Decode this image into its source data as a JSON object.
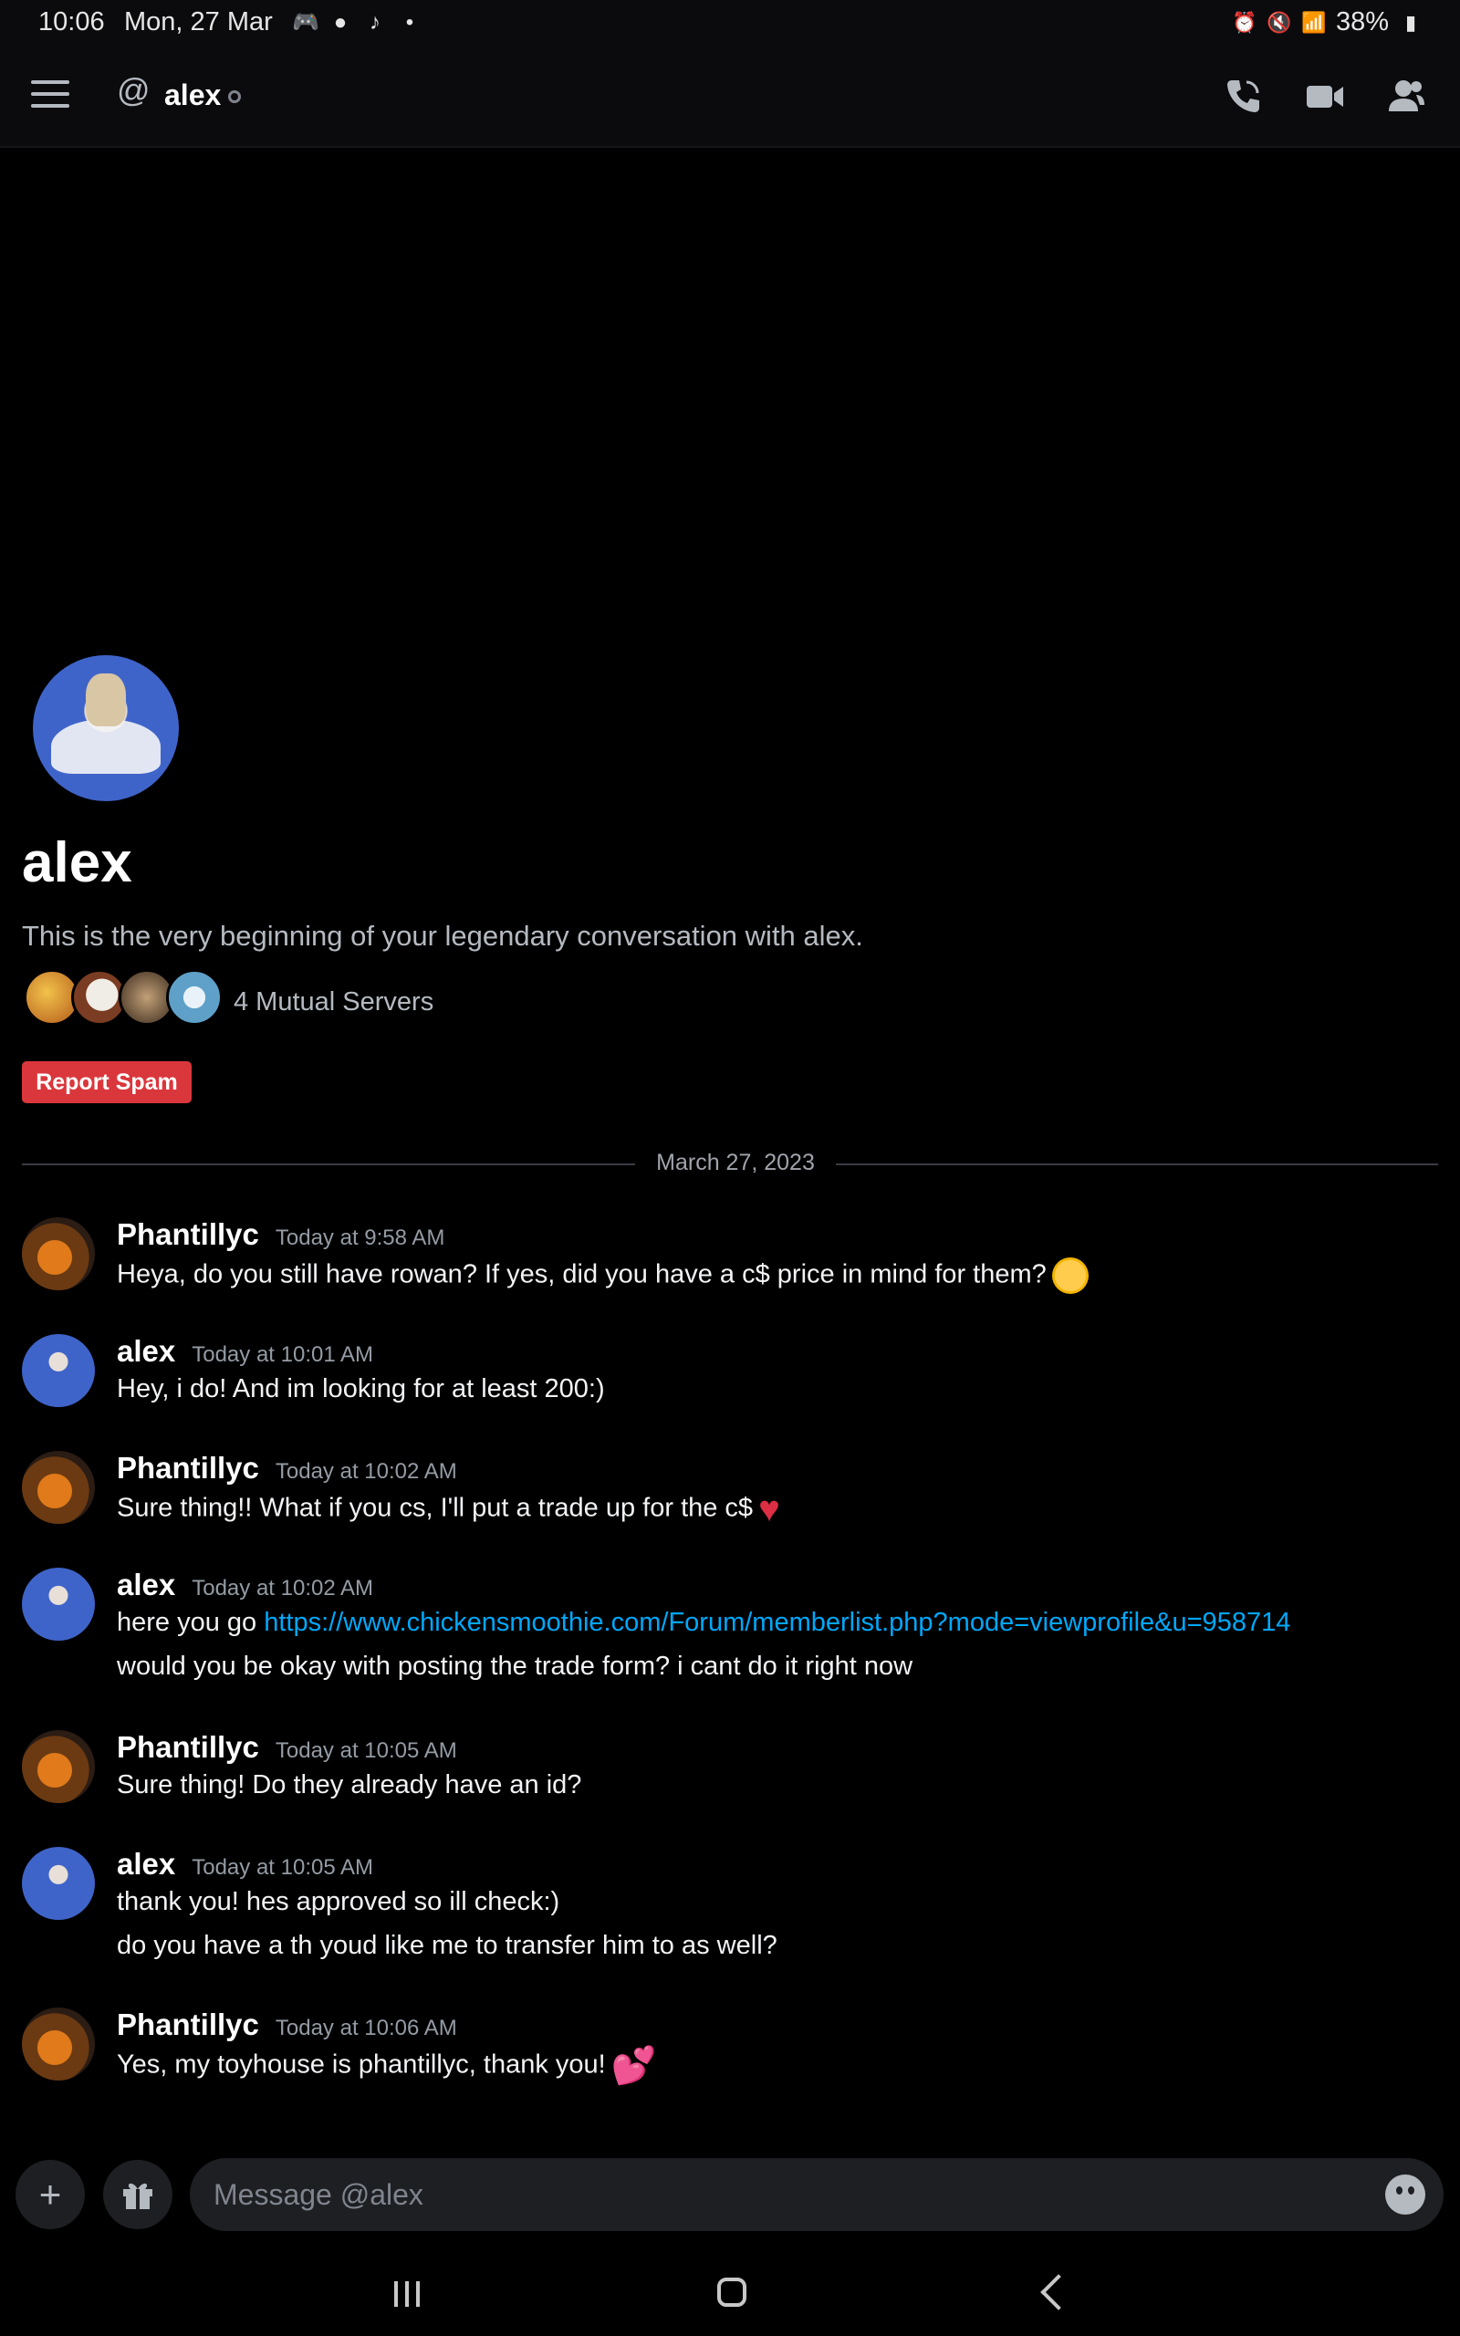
{
  "status_bar": {
    "time": "10:06",
    "date": "Mon, 27 Mar",
    "battery": "38%"
  },
  "header": {
    "title": "alex"
  },
  "intro": {
    "name": "alex",
    "description": "This is the very beginning of your legendary conversation with alex.",
    "mutual_servers": "4 Mutual Servers",
    "report_label": "Report Spam"
  },
  "divider_date": "March 27, 2023",
  "messages": [
    {
      "author": "Phantillyc",
      "timestamp": "Today at 9:58 AM",
      "lines": [
        "Heya, do you still have rowan? If yes, did you have a c$ price in mind for them?"
      ],
      "emoji": "face-with-rolling-eyes"
    },
    {
      "author": "alex",
      "timestamp": "Today at 10:01 AM",
      "lines": [
        "Hey, i do! And im looking for at least 200:)"
      ]
    },
    {
      "author": "Phantillyc",
      "timestamp": "Today at 10:02 AM",
      "lines": [
        "Sure thing!! What if you cs, I'll put a trade up for the c$"
      ],
      "emoji": "heart"
    },
    {
      "author": "alex",
      "timestamp": "Today at 10:02 AM",
      "lines": [
        "here you go",
        "would you be okay with posting the trade form? i cant do it right now"
      ],
      "link": "https://www.chickensmoothie.com/Forum/memberlist.php?mode=viewprofile&u=958714"
    },
    {
      "author": "Phantillyc",
      "timestamp": "Today at 10:05 AM",
      "lines": [
        "Sure thing! Do they already have an id?"
      ]
    },
    {
      "author": "alex",
      "timestamp": "Today at 10:05 AM",
      "lines": [
        "thank you! hes approved so ill check:)",
        "do you have a th youd like me to transfer him to as well?"
      ]
    },
    {
      "author": "Phantillyc",
      "timestamp": "Today at 10:06 AM",
      "lines": [
        "Yes, my toyhouse is phantillyc, thank you!"
      ],
      "emoji": "two-hearts"
    }
  ],
  "composer": {
    "placeholder": "Message @alex"
  },
  "colors": {
    "background": "#000000",
    "report_button": "#da373c",
    "link": "#00a8fc",
    "muted_text": "#b5bac1"
  }
}
